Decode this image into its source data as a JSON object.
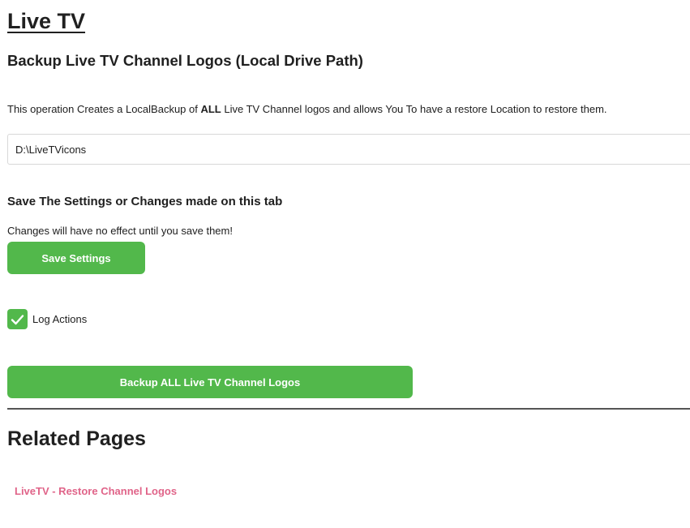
{
  "page": {
    "title": "Live TV",
    "section_title": "Backup Live TV Channel Logos (Local Drive Path)",
    "description": {
      "before": "This operation Creates a LocalBackup of ",
      "bold": "ALL",
      "after": " Live TV Channel logos and allows You To have a restore Location to restore them."
    },
    "path_input": {
      "value": "D:\\LiveTVicons"
    }
  },
  "save": {
    "title": "Save The Settings or Changes made on this tab",
    "note": "Changes will have no effect until you save them!",
    "button_label": "Save Settings"
  },
  "log_actions": {
    "label": "Log Actions",
    "checked": true,
    "icon": "checkmark-icon"
  },
  "backup": {
    "button_label": "Backup ALL Live TV Channel Logos"
  },
  "related": {
    "title": "Related Pages",
    "links": [
      {
        "label": "LiveTV - Restore Channel Logos"
      }
    ]
  },
  "colors": {
    "accent_green": "#52b84b",
    "link_pink": "#e06489",
    "divider": "#555555"
  }
}
